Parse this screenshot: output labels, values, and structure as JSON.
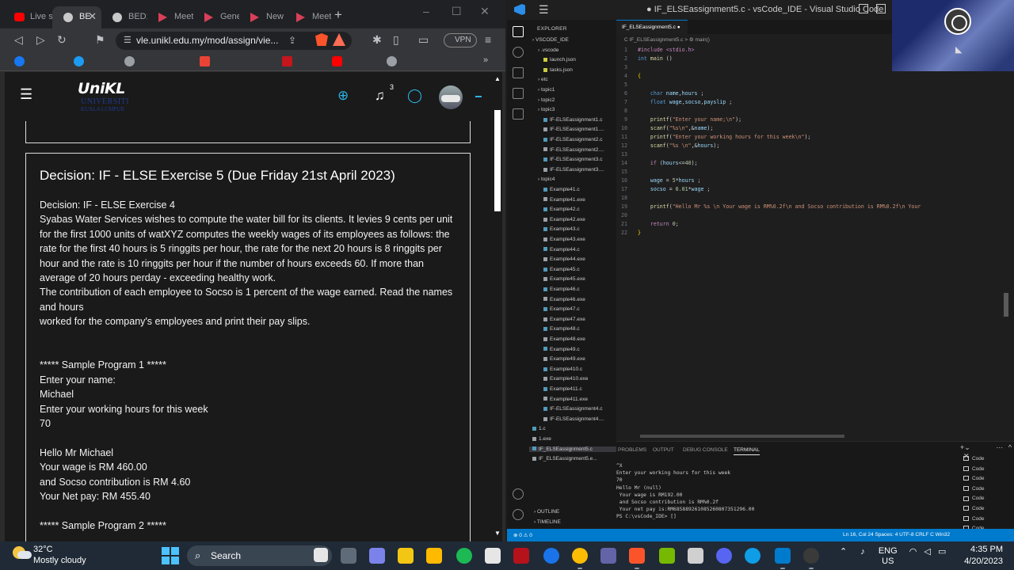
{
  "browser": {
    "tabs": [
      {
        "label": "Live s",
        "icon": "youtube-icon",
        "active": false
      },
      {
        "label": "BE",
        "icon": "moodle-icon",
        "active": true
      },
      {
        "label": "BED1",
        "icon": "moodle-icon",
        "active": false
      },
      {
        "label": "Meeti",
        "icon": "meet-icon",
        "active": false
      },
      {
        "label": "Gener",
        "icon": "meet-icon",
        "active": false
      },
      {
        "label": "New",
        "icon": "meet-icon",
        "active": false
      },
      {
        "label": "Meeti",
        "icon": "meet-icon",
        "active": false
      }
    ],
    "new_tab": "+",
    "url": "vle.unikl.edu.my/mod/assign/vie...",
    "vpn_label": "VPN",
    "accent": "#d93f58"
  },
  "moodle": {
    "logo_text": "UniKL",
    "logo_sub1": "UNIVERSITI",
    "logo_sub2": "KUALA LUMPUR",
    "notification_count": "3",
    "assignment": {
      "title": "Decision: IF - ELSE Exercise 5 (Due Friday 21st April 2023)",
      "paragraphs": [
        "Decision: IF - ELSE Exercise 4",
        "Syabas Water Services wishes to compute the water bill for its clients. It levies 9 cents per unit for the first 1000 units of watXYZ computes the weekly wages of its employees as follows: the rate for the first 40 hours is 5 ringgits per hour, the rate for the next 20 hours is 8 ringgits per hour and the rate is 10 ringgits per hour if the number of hours exceeds 60. If more than average of 20 hours perday - exceeding healthy work.",
        "The contribution of each employee to Socso is 1 percent of the wage earned. Read the names and hours",
        "worked for the company's employees and print their pay slips."
      ],
      "sample1": [
        "*****  Sample Program  1 *****",
        "Enter your name:",
        "Michael",
        "Enter your working hours for this week",
        "70"
      ],
      "output1": [
        "Hello Mr Michael",
        "Your wage is RM 460.00",
        "and Socso contribution is RM 4.60",
        "Your Net pay: RM 455.40"
      ],
      "sample2_header": "*****  Sample Program  2 *****"
    }
  },
  "vscode": {
    "title": "● IF_ELSEassignment5.c - vsCode_IDE - Visual Studio Code",
    "explorer_header": "EXPLORER",
    "tree": [
      {
        "label": "VSCODE_IDE",
        "indent": 0,
        "kind": "root"
      },
      {
        "label": ".vscode",
        "indent": 1,
        "kind": "folder"
      },
      {
        "label": "launch.json",
        "indent": 2,
        "kind": "json"
      },
      {
        "label": "tasks.json",
        "indent": 2,
        "kind": "json"
      },
      {
        "label": "etc",
        "indent": 1,
        "kind": "folder"
      },
      {
        "label": "topic1",
        "indent": 1,
        "kind": "folder"
      },
      {
        "label": "topic2",
        "indent": 1,
        "kind": "folder"
      },
      {
        "label": "topic3",
        "indent": 1,
        "kind": "folder"
      },
      {
        "label": "IF-ELSEassignment1.c",
        "indent": 2,
        "kind": "c"
      },
      {
        "label": "IF-ELSEassignment1....",
        "indent": 2,
        "kind": "exe"
      },
      {
        "label": "IF-ELSEassignment2.c",
        "indent": 2,
        "kind": "c"
      },
      {
        "label": "IF-ELSEassignment2....",
        "indent": 2,
        "kind": "exe"
      },
      {
        "label": "IF-ELSEassignment3.c",
        "indent": 2,
        "kind": "c"
      },
      {
        "label": "IF-ELSEassignment3....",
        "indent": 2,
        "kind": "exe"
      },
      {
        "label": "topic4",
        "indent": 1,
        "kind": "folder"
      },
      {
        "label": "Example41.c",
        "indent": 2,
        "kind": "c"
      },
      {
        "label": "Example41.exe",
        "indent": 2,
        "kind": "exe"
      },
      {
        "label": "Example42.c",
        "indent": 2,
        "kind": "c"
      },
      {
        "label": "Example42.exe",
        "indent": 2,
        "kind": "exe"
      },
      {
        "label": "Example43.c",
        "indent": 2,
        "kind": "c"
      },
      {
        "label": "Example43.exe",
        "indent": 2,
        "kind": "exe"
      },
      {
        "label": "Example44.c",
        "indent": 2,
        "kind": "c"
      },
      {
        "label": "Example44.exe",
        "indent": 2,
        "kind": "exe"
      },
      {
        "label": "Example45.c",
        "indent": 2,
        "kind": "c"
      },
      {
        "label": "Example45.exe",
        "indent": 2,
        "kind": "exe"
      },
      {
        "label": "Example46.c",
        "indent": 2,
        "kind": "c"
      },
      {
        "label": "Example46.exe",
        "indent": 2,
        "kind": "exe"
      },
      {
        "label": "Example47.c",
        "indent": 2,
        "kind": "c"
      },
      {
        "label": "Example47.exe",
        "indent": 2,
        "kind": "exe"
      },
      {
        "label": "Example48.c",
        "indent": 2,
        "kind": "c"
      },
      {
        "label": "Example48.exe",
        "indent": 2,
        "kind": "exe"
      },
      {
        "label": "Example49.c",
        "indent": 2,
        "kind": "c"
      },
      {
        "label": "Example49.exe",
        "indent": 2,
        "kind": "exe"
      },
      {
        "label": "Example410.c",
        "indent": 2,
        "kind": "c"
      },
      {
        "label": "Example410.exe",
        "indent": 2,
        "kind": "exe"
      },
      {
        "label": "Example411.c",
        "indent": 2,
        "kind": "c"
      },
      {
        "label": "Example411.exe",
        "indent": 2,
        "kind": "exe"
      },
      {
        "label": "IF-ELSEassignment4.c",
        "indent": 2,
        "kind": "c"
      },
      {
        "label": "IF-ELSEassignment4....",
        "indent": 2,
        "kind": "exe"
      },
      {
        "label": "1.c",
        "indent": 0,
        "kind": "c"
      },
      {
        "label": "1.exe",
        "indent": 0,
        "kind": "exe"
      },
      {
        "label": "IF_ELSEassignment5.c",
        "indent": 0,
        "kind": "c",
        "selected": true
      },
      {
        "label": "IF_ELSEassignment5.e...",
        "indent": 0,
        "kind": "exe"
      }
    ],
    "outline_label": "OUTLINE",
    "timeline_label": "TIMELINE",
    "editor_tab": "IF_ELSEassignment5.c ●",
    "breadcrumb": "C  IF_ELSEassignment5.c  >  ⚙ main()",
    "code": [
      "#include <stdio.h>",
      "int main ()",
      "",
      "{",
      "",
      "    char name,hours ;",
      "    float wage,socso,payslip ;",
      "",
      "    printf(\"Enter your name;\\n\");",
      "    scanf(\"%s\\n\",&name);",
      "    printf(\"Enter your working hours for this week\\n\");",
      "    scanf(\"%s \\n\",&hours);",
      "",
      "    if (hours<=40);",
      "",
      "    wage = 5*hours ;",
      "    socso = 0.01*wage ;",
      "",
      "    printf(\"Hello Mr %s \\n Your wage is RM%0.2f\\n and Socso contribution is RM%0.2f\\n Your",
      "",
      "    return 0;",
      "}"
    ],
    "panel_tabs": [
      "PROBLEMS",
      "OUTPUT",
      "DEBUG CONSOLE",
      "TERMINAL"
    ],
    "terminal": [
      "^X",
      "Enter your working hours for this week",
      "70",
      "Hello Mr (null)",
      " Your wage is RM192.00",
      " and Socso contribution is RM%0.2f",
      " Your net pay is:RM685889261085260807351296.00",
      "PS C:\\vsCode_IDE> []"
    ],
    "terminal_list": [
      "Code",
      "Code",
      "Code",
      "Code",
      "Code",
      "Code",
      "Code",
      "Code"
    ],
    "status_left": "⊗ 0 ⚠ 0",
    "status_right": "Ln 16, Col 24   Spaces: 4   UTF-8   CRLF   C   Win32"
  },
  "taskbar": {
    "temperature": "32°C",
    "weather": "Mostly cloudy",
    "search_label": "Search",
    "language": "ENG",
    "region": "US",
    "time": "4:35 PM",
    "date": "4/20/2023"
  }
}
